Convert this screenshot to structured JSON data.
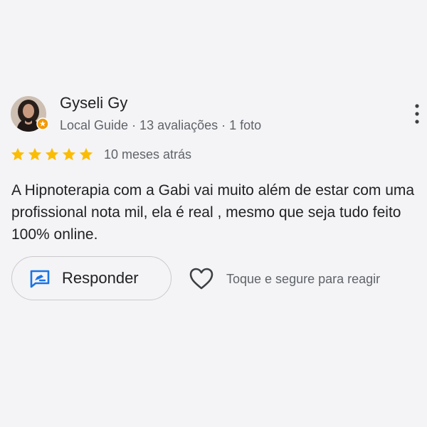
{
  "review": {
    "author_name": "Gyseli Gy",
    "author_meta": "Local Guide · 13 avaliações · 1 foto",
    "rating": 5,
    "max_rating": 5,
    "date": "10 meses atrás",
    "text": "A Hipnoterapia com a Gabi vai muito além de estar com uma profissional nota mil, ela é real , mesmo que seja tudo feito 100% online."
  },
  "actions": {
    "reply_label": "Responder",
    "react_label": "Toque e segure para reagir"
  },
  "icons": {
    "more": "more-vert-icon",
    "reply": "reply-icon",
    "heart": "heart-outline-icon",
    "star": "star-icon",
    "badge": "local-guide-badge-icon"
  },
  "colors": {
    "star": "#fbbc04",
    "reply_icon": "#1a73e8",
    "background": "#f4f4f6",
    "text_primary": "#202124",
    "text_secondary": "#5f6368"
  }
}
